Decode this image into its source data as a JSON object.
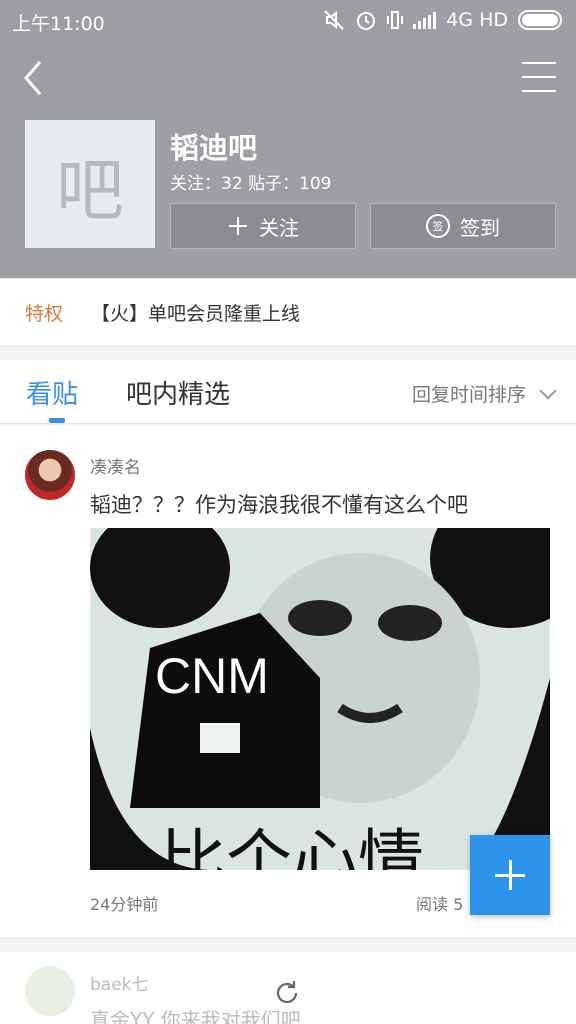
{
  "status_bar": {
    "time": "上午11:00",
    "network": "4G HD",
    "icons": [
      "mute-icon",
      "alarm-icon",
      "vibrate-icon",
      "signal-icon",
      "battery-icon"
    ]
  },
  "header": {
    "logo_char": "吧",
    "bar_name": "韬迪吧",
    "stats": "关注：32   贴子：109",
    "follow_label": "关注",
    "follow_icon": "plus-icon",
    "sign_label": "签到",
    "sign_icon_char": "签",
    "background": "#9d9fa4"
  },
  "privilege": {
    "tag": "特权",
    "text": "【火】单吧会员隆重上线"
  },
  "tabs": {
    "items": [
      {
        "label": "看贴",
        "active": true
      },
      {
        "label": "吧内精选",
        "active": false
      }
    ],
    "sort_label": "回复时间排序",
    "accent": "#3b8fe0"
  },
  "post": {
    "author": "凑凑名",
    "title": "韬迪？？？作为海浪我很不懂有这么个吧",
    "image_caption_top": "CNM",
    "image_caption_bottom": "比个心情",
    "time": "24分钟前",
    "read": "阅读 5"
  },
  "next_post": {
    "author": "baek七",
    "title": "真金YY 你来我对我们吧"
  }
}
